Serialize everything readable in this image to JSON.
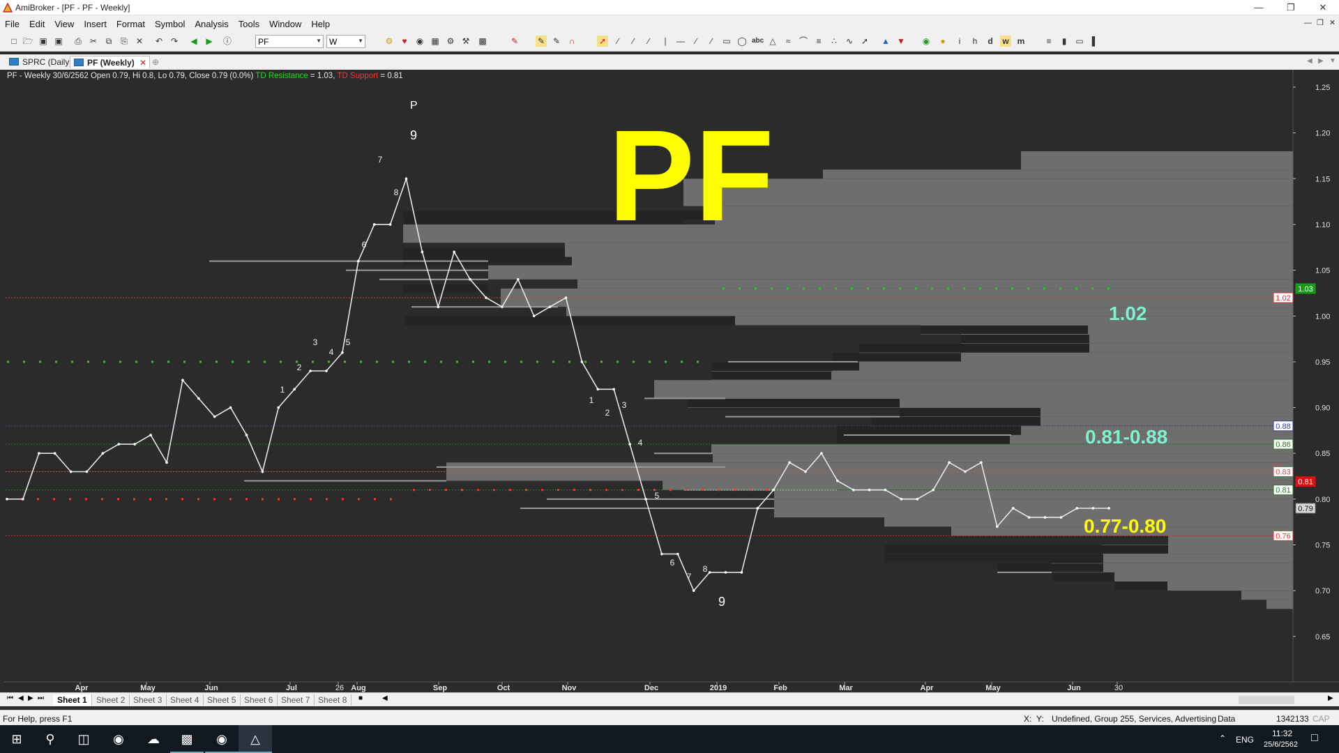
{
  "window": {
    "title": "AmiBroker - [PF - PF - Weekly]"
  },
  "menu": [
    "File",
    "Edit",
    "View",
    "Insert",
    "Format",
    "Symbol",
    "Analysis",
    "Tools",
    "Window",
    "Help"
  ],
  "toolbar": {
    "symbol_value": "PF",
    "interval_value": "W"
  },
  "doc_tabs": [
    {
      "label": "SPRC (Daily)",
      "active": false
    },
    {
      "label": "PF (Weekly)",
      "active": true
    }
  ],
  "chart": {
    "header_text": "PF - Weekly 30/6/2562 Open 0.79, Hi 0.8, Lo 0.79, Close 0.79 (0.0%)",
    "td_resistance_label": "TD Resistance",
    "td_resistance_value": " = 1.03,",
    "td_support_label": "TD Support",
    "td_support_value": " = 0.81",
    "overlay_title": "PF",
    "annotation_top": "1.02",
    "annotation_mid": "0.81-0.88",
    "annotation_low": "0.77-0.80",
    "setup_top_marker": "P",
    "setup_top_nine": "9",
    "setup_bottom_nine": "9",
    "colors": {
      "background": "#2b2b2b",
      "price_line": "#e6e6e6",
      "overlay_yellow": "#ffff00",
      "annotation_teal": "#7ff0d0",
      "resistance_red": "#ff3030",
      "support_green": "#22cc22",
      "volume_profile": "#6e6e6e"
    }
  },
  "chart_data": {
    "type": "line",
    "title": "PF",
    "xlabel": "",
    "ylabel": "",
    "ylim": [
      0.61,
      1.28
    ],
    "x_tick_labels": [
      "Apr",
      "May",
      "Jun",
      "Jul",
      "26",
      "Aug",
      "Sep",
      "Oct",
      "Nov",
      "Dec",
      "2019",
      "Feb",
      "Mar",
      "Apr",
      "May",
      "Jun",
      "30"
    ],
    "y_tick_labels": [
      "1.25",
      "1.20",
      "1.15",
      "1.10",
      "1.05",
      "1.00",
      "0.95",
      "0.90",
      "0.85",
      "0.80",
      "0.75",
      "0.70",
      "0.65"
    ],
    "series": [
      {
        "values": [
          0.8,
          0.8,
          0.85,
          0.85,
          0.83,
          0.83,
          0.85,
          0.86,
          0.86,
          0.87,
          0.84,
          0.93,
          0.91,
          0.89,
          0.9,
          0.87,
          0.83,
          0.9,
          0.92,
          0.94,
          0.94,
          0.96,
          1.06,
          1.1,
          1.1,
          1.15,
          1.07,
          1.01,
          1.07,
          1.04,
          1.02,
          1.01,
          1.04,
          1.0,
          1.01,
          1.02,
          0.95,
          0.92,
          0.92,
          0.86,
          0.8,
          0.74,
          0.74,
          0.7,
          0.72,
          0.72,
          0.72,
          0.79,
          0.81,
          0.84,
          0.83,
          0.85,
          0.82,
          0.81,
          0.81,
          0.81,
          0.8,
          0.8,
          0.81,
          0.84,
          0.83,
          0.84,
          0.77,
          0.79,
          0.78,
          0.78,
          0.78,
          0.79,
          0.79,
          0.79
        ]
      }
    ],
    "price_levels": [
      {
        "label": "1.03",
        "value": 1.03
      },
      {
        "label": "1.02",
        "value": 1.02
      },
      {
        "label": "0.88",
        "value": 0.88
      },
      {
        "label": "0.86",
        "value": 0.86
      },
      {
        "label": "0.83",
        "value": 0.83
      },
      {
        "label": "0.81",
        "value": 0.81
      },
      {
        "label": "0.81",
        "value": 0.81
      },
      {
        "label": "0.79",
        "value": 0.79
      },
      {
        "label": "0.76",
        "value": 0.76
      }
    ],
    "td_upper_numbers": [
      "1",
      "2",
      "3",
      "4",
      "5",
      "6",
      "7",
      "8"
    ],
    "td_lower_numbers": [
      "1",
      "2",
      "3",
      "4",
      "5",
      "6",
      "7",
      "8"
    ],
    "grid": false
  },
  "sheets": [
    "Sheet 1",
    "Sheet 2",
    "Sheet 3",
    "Sheet 4",
    "Sheet 5",
    "Sheet 6",
    "Sheet 7",
    "Sheet 8"
  ],
  "status": {
    "help": "For Help, press F1",
    "x": "X:",
    "y": "Y:",
    "info": "Undefined, Group 255, Services, Advertising",
    "data": "Data",
    "count": "1342133",
    "cap": "CAP"
  },
  "taskbar": {
    "lang": "ENG",
    "time": "11:32",
    "date": "25/6/2562"
  }
}
